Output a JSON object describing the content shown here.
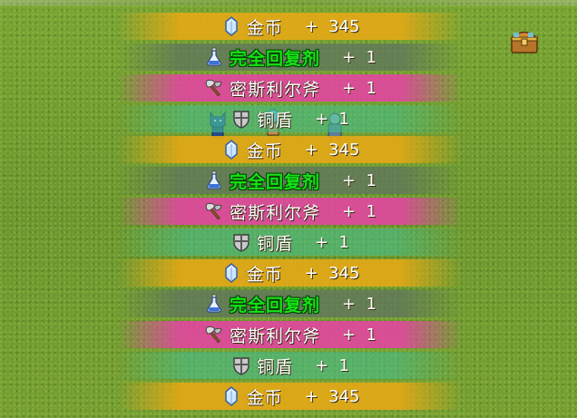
{
  "colors": {
    "gold_band": "#e2a816",
    "potion_band": "#5f735f",
    "axe_band": "#e246a0",
    "shield_band": "#46be8c",
    "potion_text": "#14e414",
    "grass": "#6f9a2e"
  },
  "loot_rows": [
    {
      "type": "gold",
      "icon": "crystal-icon",
      "name": "金币",
      "qty": "+  345"
    },
    {
      "type": "potion",
      "icon": "potion-icon",
      "name": "完全回复剂",
      "qty": "+  1"
    },
    {
      "type": "axe",
      "icon": "axe-icon",
      "name": "密斯利尔斧",
      "qty": "+  1"
    },
    {
      "type": "shield",
      "icon": "shield-icon",
      "name": "铜盾",
      "qty": "+  1"
    },
    {
      "type": "gold",
      "icon": "crystal-icon",
      "name": "金币",
      "qty": "+  345"
    },
    {
      "type": "potion",
      "icon": "potion-icon",
      "name": "完全回复剂",
      "qty": "+  1"
    },
    {
      "type": "axe",
      "icon": "axe-icon",
      "name": "密斯利尔斧",
      "qty": "+  1"
    },
    {
      "type": "shield",
      "icon": "shield-icon",
      "name": "铜盾",
      "qty": "+  1"
    },
    {
      "type": "gold",
      "icon": "crystal-icon",
      "name": "金币",
      "qty": "+  345"
    },
    {
      "type": "potion",
      "icon": "potion-icon",
      "name": "完全回复剂",
      "qty": "+  1"
    },
    {
      "type": "axe",
      "icon": "axe-icon",
      "name": "密斯利尔斧",
      "qty": "+  1"
    },
    {
      "type": "shield",
      "icon": "shield-icon",
      "name": "铜盾",
      "qty": "+  1"
    },
    {
      "type": "gold",
      "icon": "crystal-icon",
      "name": "金币",
      "qty": "+  345"
    }
  ],
  "hud": {
    "chest_icon": "treasure-chest-icon"
  }
}
